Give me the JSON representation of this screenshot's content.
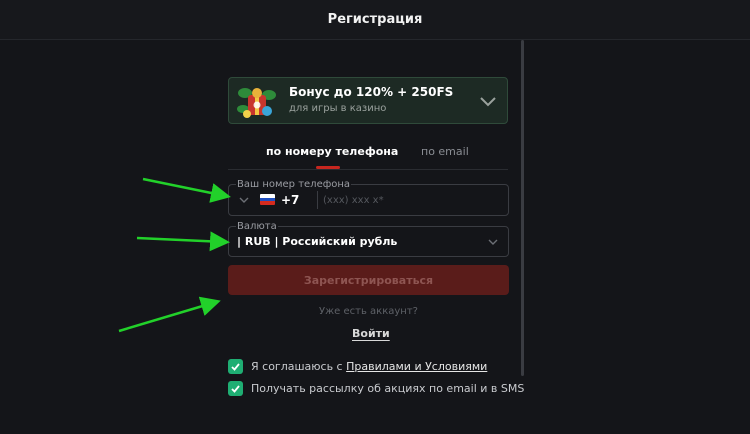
{
  "header": {
    "title": "Регистрация"
  },
  "bonus": {
    "title": "Бонус до 120% + 250FS",
    "subtitle": "для игры в казино",
    "icon": "gift-icon",
    "chevron_icon": "chevron-down-icon"
  },
  "tabs": [
    {
      "label": "по номеру телефона",
      "active": true
    },
    {
      "label": "по email",
      "active": false
    }
  ],
  "phone": {
    "label": "Ваш номер телефона",
    "country_flag": "russia-flag-icon",
    "code": "+7",
    "placeholder": "(xxx) xxx x*"
  },
  "currency": {
    "label": "Валюта",
    "value": "| RUB | Российский рубль"
  },
  "register_button": {
    "label": "Зарегистрироваться"
  },
  "login": {
    "prompt": "Уже есть аккаунт?",
    "link": "Войти"
  },
  "agreements": [
    {
      "prefix": "Я соглашаюсь с ",
      "link": "Правилами и Условиями",
      "checked": true
    },
    {
      "text": "Получать рассылку об акциях по email и в SMS",
      "checked": true
    }
  ],
  "colors": {
    "background": "#141519",
    "accent_red": "#c7261f",
    "button_disabled": "#5a1c1a",
    "checkbox_green": "#1fae73",
    "annotation_arrow": "#22d12a"
  }
}
